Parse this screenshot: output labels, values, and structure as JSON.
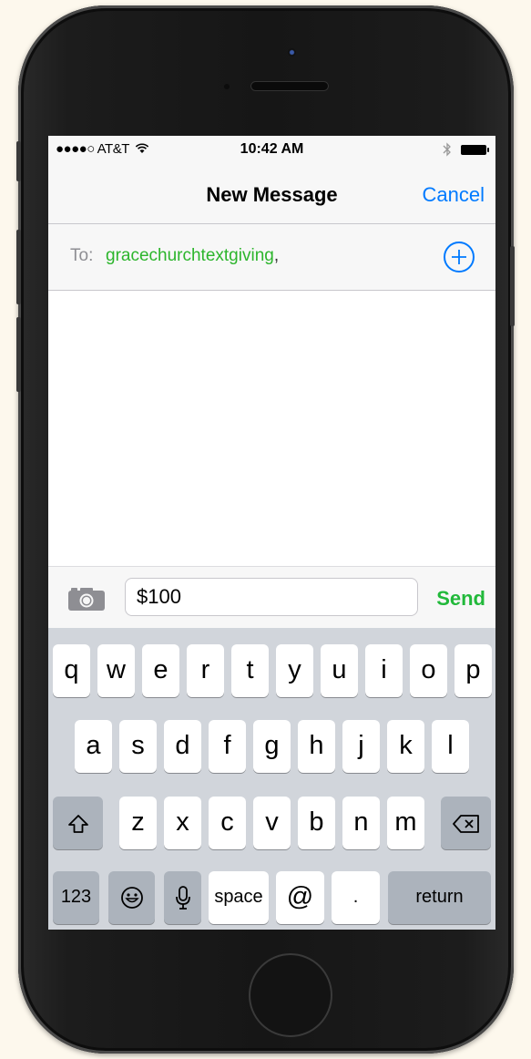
{
  "status_bar": {
    "carrier": "●●●●○ AT&T",
    "wifi_icon": "wifi-icon",
    "time": "10:42 AM",
    "bluetooth_icon": "bluetooth-icon",
    "battery_icon": "battery-icon"
  },
  "nav": {
    "title": "New Message",
    "cancel_label": "Cancel"
  },
  "to_field": {
    "label": "To:",
    "recipient": "gracechurchtextgiving",
    "separator": ",",
    "add_icon": "plus-circle-icon"
  },
  "compose": {
    "camera_icon": "camera-icon",
    "message_value": "$100",
    "send_label": "Send"
  },
  "keyboard": {
    "row1": [
      "q",
      "w",
      "e",
      "r",
      "t",
      "y",
      "u",
      "i",
      "o",
      "p"
    ],
    "row2": [
      "a",
      "s",
      "d",
      "f",
      "g",
      "h",
      "j",
      "k",
      "l"
    ],
    "row3": [
      "z",
      "x",
      "c",
      "v",
      "b",
      "n",
      "m"
    ],
    "shift_icon": "shift-icon",
    "delete_icon": "delete-icon",
    "numbers_label": "123",
    "emoji_icon": "emoji-icon",
    "mic_icon": "microphone-icon",
    "space_label": "space",
    "at_label": "@",
    "period_label": ".",
    "return_label": "return"
  },
  "colors": {
    "accent_blue": "#007aff",
    "recipient_green": "#2cb52c",
    "send_green": "#22b93b",
    "keyboard_bg": "#d1d5db"
  }
}
